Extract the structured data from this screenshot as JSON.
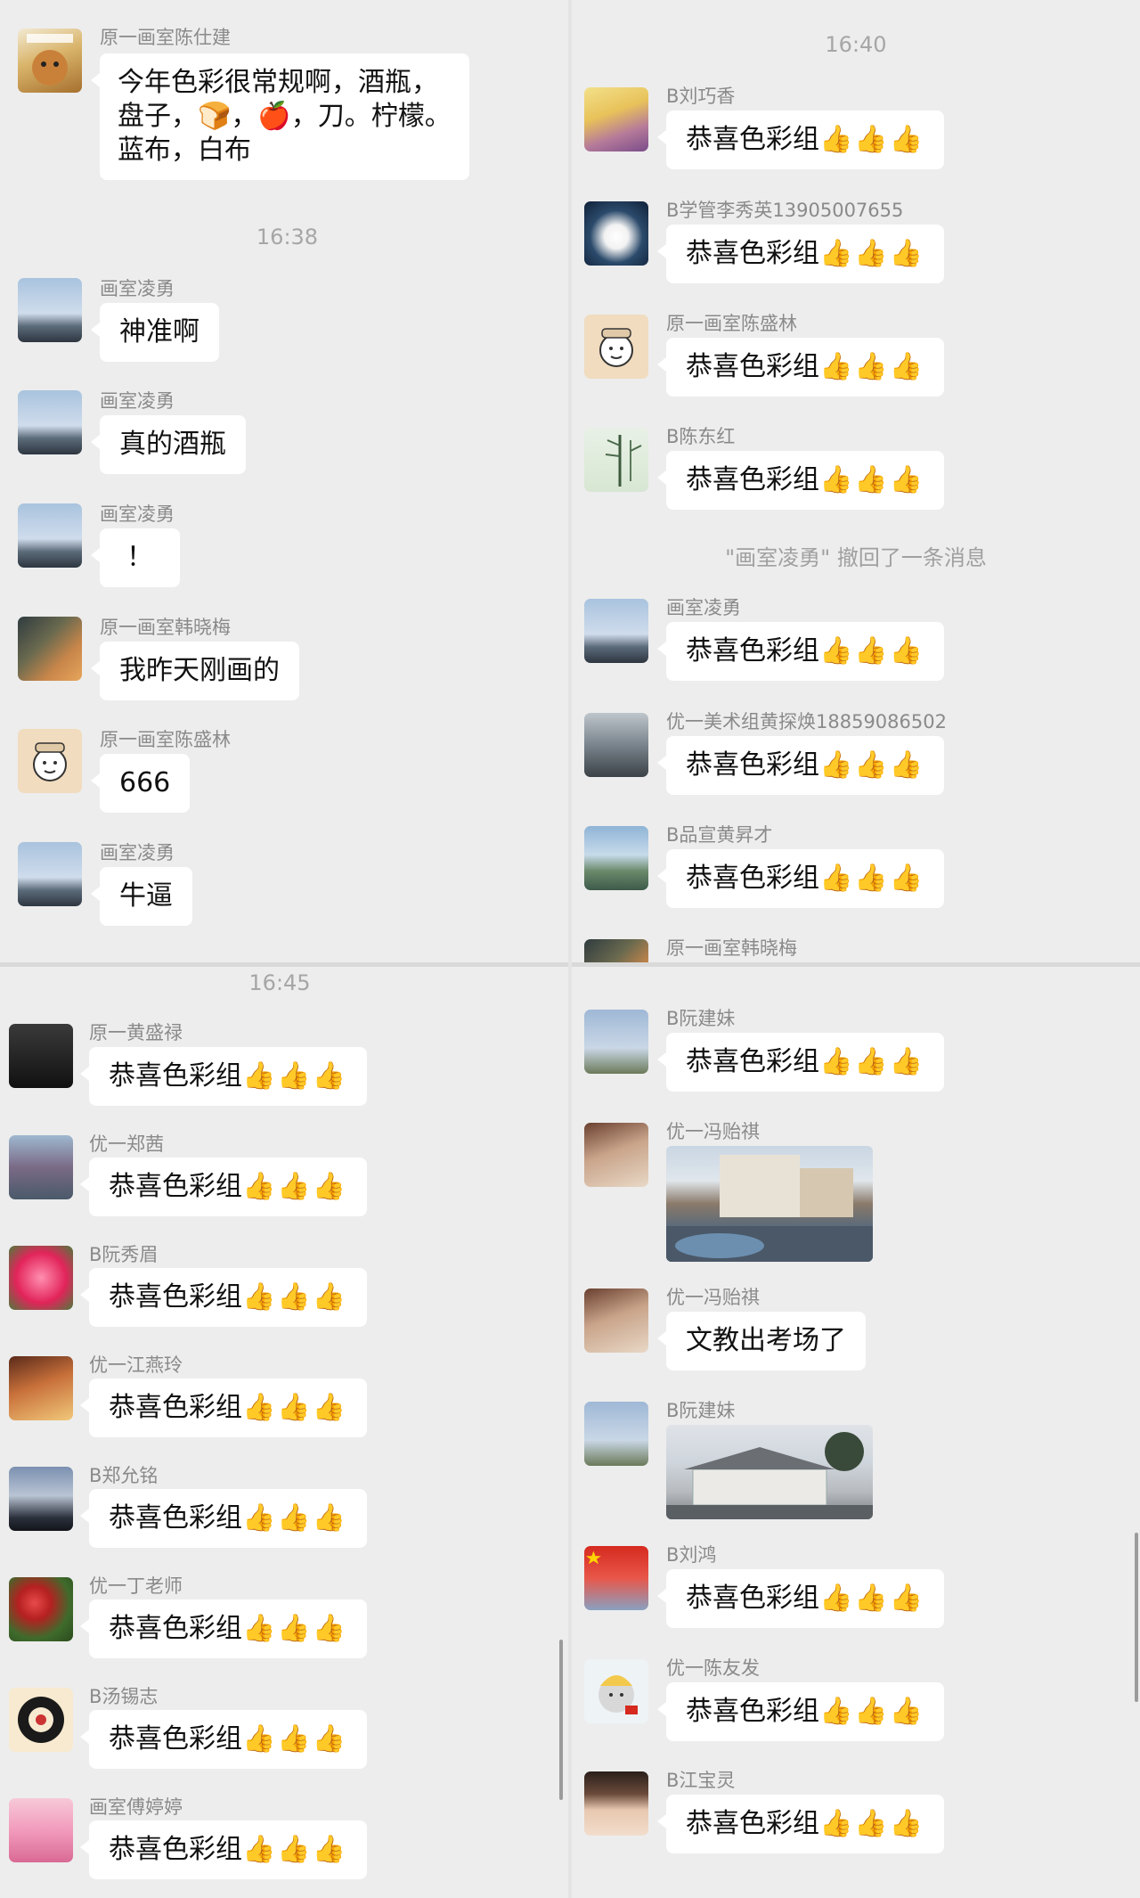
{
  "panels": {
    "p1": {
      "messages": [
        {
          "sender": "原一画室陈仕建",
          "lines": [
            "今年色彩很常规啊，酒瓶，",
            "盘子，🍞，🍎，刀。柠檬。",
            "蓝布，白布"
          ]
        },
        {
          "time": "16:38"
        },
        {
          "sender": "画室凌勇",
          "text": "神准啊"
        },
        {
          "sender": "画室凌勇",
          "text": "真的酒瓶"
        },
        {
          "sender": "画室凌勇",
          "text": "！"
        },
        {
          "sender": "原一画室韩晓梅",
          "text": "我昨天刚画的"
        },
        {
          "sender": "原一画室陈盛林",
          "text": "666"
        },
        {
          "sender": "画室凌勇",
          "text": "牛逼"
        }
      ]
    },
    "p2": {
      "time": "16:40",
      "messages": [
        {
          "sender": "B刘巧香",
          "text": "恭喜色彩组",
          "thumbs": "👍👍👍"
        },
        {
          "sender": "B学管李秀英13905007655",
          "text": "恭喜色彩组",
          "thumbs": "👍👍👍"
        },
        {
          "sender": "原一画室陈盛林",
          "text": "恭喜色彩组",
          "thumbs": "👍👍👍"
        },
        {
          "sender": "B陈东红",
          "text": "恭喜色彩组",
          "thumbs": "👍👍👍"
        },
        {
          "system": "\"画室凌勇\" 撤回了一条消息"
        },
        {
          "sender": "画室凌勇",
          "text": "恭喜色彩组",
          "thumbs": "👍👍👍"
        },
        {
          "sender": "优一美术组黄探焕18859086502",
          "text": "恭喜色彩组",
          "thumbs": "👍👍👍"
        },
        {
          "sender": "B品宣黄昇才",
          "text": "恭喜色彩组",
          "thumbs": "👍👍👍"
        },
        {
          "sender": "原一画室韩晓梅"
        }
      ]
    },
    "p3": {
      "time": "16:45",
      "messages": [
        {
          "sender": "原一黄盛禄",
          "text": "恭喜色彩组",
          "thumbs": "👍👍👍"
        },
        {
          "sender": "优一郑茜",
          "text": "恭喜色彩组",
          "thumbs": "👍👍👍"
        },
        {
          "sender": "B阮秀眉",
          "text": "恭喜色彩组",
          "thumbs": "👍👍👍"
        },
        {
          "sender": "优一江燕玲",
          "text": "恭喜色彩组",
          "thumbs": "👍👍👍"
        },
        {
          "sender": "B郑允铭",
          "text": "恭喜色彩组",
          "thumbs": "👍👍👍"
        },
        {
          "sender": "优一丁老师",
          "text": "恭喜色彩组",
          "thumbs": "👍👍👍"
        },
        {
          "sender": "B汤锡志",
          "text": "恭喜色彩组",
          "thumbs": "👍👍👍"
        },
        {
          "sender": "画室傅婷婷",
          "text": "恭喜色彩组",
          "thumbs": "👍👍👍"
        }
      ]
    },
    "p4": {
      "messages": [
        {
          "sender": "B阮建妹",
          "text": "恭喜色彩组",
          "thumbs": "👍👍👍"
        },
        {
          "sender": "优一冯贻祺",
          "photo": "street-photo"
        },
        {
          "sender": "优一冯贻祺",
          "text": "文教出考场了"
        },
        {
          "sender": "B阮建妹",
          "photo": "building-photo"
        },
        {
          "sender": "B刘鸿",
          "text": "恭喜色彩组",
          "thumbs": "👍👍👍"
        },
        {
          "sender": "优一陈友发",
          "text": "恭喜色彩组",
          "thumbs": "👍👍👍"
        },
        {
          "sender": "B江宝灵",
          "text": "恭喜色彩组",
          "thumbs": "👍👍👍"
        }
      ]
    }
  },
  "colors": {
    "background": "#ededed",
    "bubble": "#ffffff",
    "meta_text": "#8a8a8a"
  }
}
